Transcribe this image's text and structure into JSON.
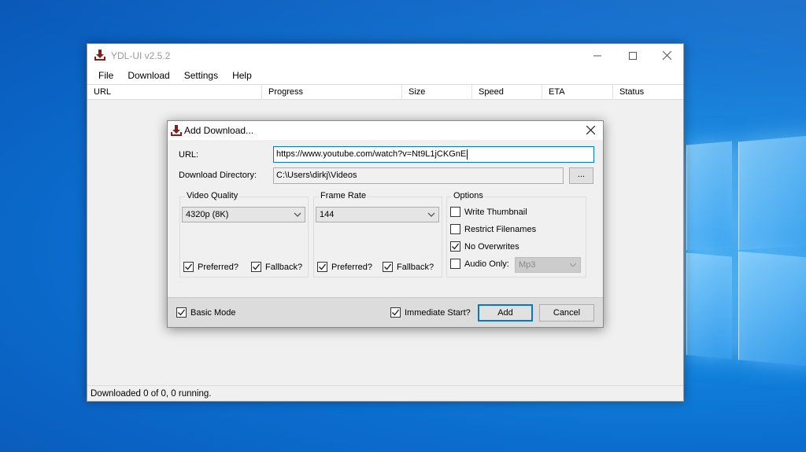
{
  "app": {
    "title": "YDL-UI v2.5.2",
    "menu": [
      "File",
      "Download",
      "Settings",
      "Help"
    ],
    "window_controls": {
      "minimize": "—",
      "maximize": "☐",
      "close": "✕"
    }
  },
  "table": {
    "columns": [
      "URL",
      "Progress",
      "Size",
      "Speed",
      "ETA",
      "Status"
    ],
    "rows": []
  },
  "status_bar": "Downloaded 0 of 0, 0 running.",
  "dialog": {
    "title": "Add Download...",
    "close": "✕",
    "url_label": "URL:",
    "url_value": "https://www.youtube.com/watch?v=Nt9L1jCKGnE",
    "dir_label": "Download Directory:",
    "dir_value": "C:\\Users\\dirkj\\Videos",
    "browse_label": "...",
    "video_quality": {
      "label": "Video Quality",
      "selected": "4320p (8K)",
      "preferred_label": "Preferred?",
      "preferred_checked": true,
      "fallback_label": "Fallback?",
      "fallback_checked": true
    },
    "frame_rate": {
      "label": "Frame Rate",
      "selected": "144",
      "preferred_label": "Preferred?",
      "preferred_checked": true,
      "fallback_label": "Fallback?",
      "fallback_checked": true
    },
    "options": {
      "label": "Options",
      "write_thumbnail_label": "Write Thumbnail",
      "write_thumbnail_checked": false,
      "restrict_filenames_label": "Restrict Filenames",
      "restrict_filenames_checked": false,
      "no_overwrites_label": "No Overwrites",
      "no_overwrites_checked": true,
      "audio_only_label": "Audio Only:",
      "audio_only_checked": false,
      "audio_format": "Mp3"
    },
    "basic_mode_label": "Basic Mode",
    "basic_mode_checked": true,
    "immediate_start_label": "Immediate Start?",
    "immediate_start_checked": true,
    "add_label": "Add",
    "cancel_label": "Cancel"
  },
  "colors": {
    "accent": "#0078d7",
    "icon_red": "#8b1a1a",
    "desktop_blue": "#0b6fd0"
  }
}
